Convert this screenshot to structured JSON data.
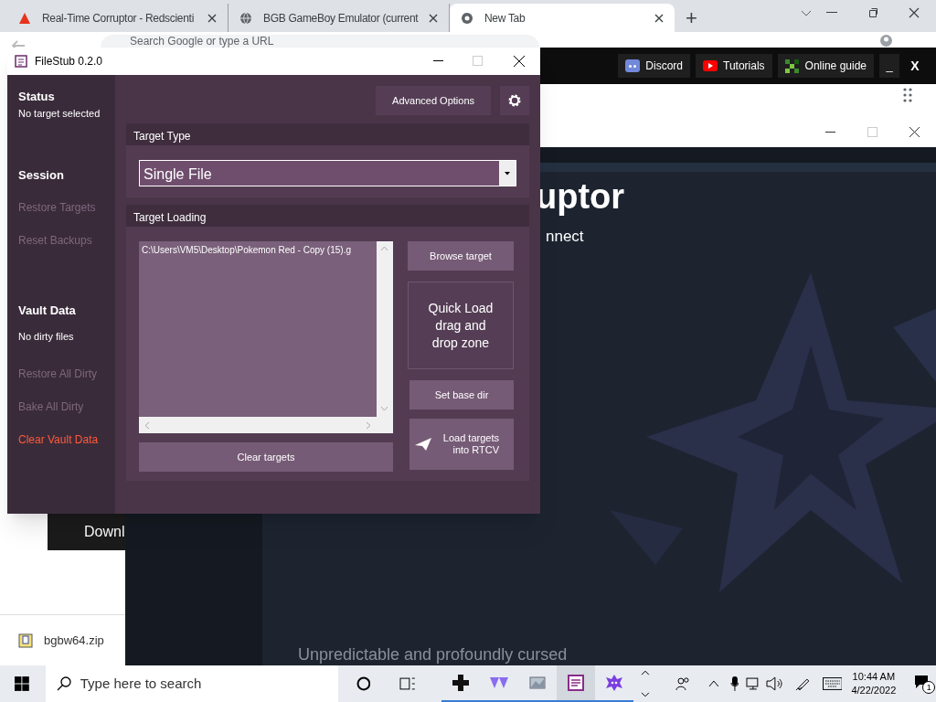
{
  "browser": {
    "tabs": [
      {
        "title": "Real-Time Corruptor - Redscienti",
        "selected": false
      },
      {
        "title": "BGB GameBoy Emulator (current",
        "selected": false
      },
      {
        "title": "New Tab",
        "selected": true
      }
    ],
    "new_tab": "+",
    "address_placeholder": "Search Google or type a URL"
  },
  "launcher_bar": {
    "links": [
      {
        "label": "Discord"
      },
      {
        "label": "Tutorials"
      },
      {
        "label": "Online guide"
      }
    ],
    "minimize": "_",
    "close": "X"
  },
  "rtcv_window": {
    "title_fragment": "uptor",
    "subtitle_fragment": "nnect",
    "tagline": "Unpredictable and profoundly cursed"
  },
  "download_button": "Downl",
  "downloads": [
    {
      "file": "bgbw64.zip"
    }
  ],
  "filestub": {
    "title": "FileStub 0.2.0",
    "sidebar": [
      {
        "kind": "heading",
        "text": "Status"
      },
      {
        "kind": "info",
        "text": "No target selected"
      },
      {
        "kind": "heading",
        "text": "Session"
      },
      {
        "kind": "action",
        "text": "Restore Targets",
        "disabled": true
      },
      {
        "kind": "action",
        "text": "Reset Backups",
        "disabled": true
      },
      {
        "kind": "heading",
        "text": "Vault Data"
      },
      {
        "kind": "info",
        "text": "No dirty files"
      },
      {
        "kind": "action",
        "text": "Restore All Dirty",
        "disabled": true
      },
      {
        "kind": "action",
        "text": "Bake All Dirty",
        "disabled": true
      },
      {
        "kind": "danger",
        "text": "Clear Vault Data",
        "disabled": false
      }
    ],
    "advanced_button": "Advanced Options",
    "target_type": {
      "header": "Target Type",
      "value": "Single File"
    },
    "target_loading": {
      "header": "Target Loading",
      "targets": [
        "C:\\Users\\VM5\\Desktop\\Pokemon Red - Copy (15).g"
      ],
      "browse": "Browse target",
      "drop_zone": "Quick Load drag and drop zone",
      "base_dir": "Set base dir",
      "load": "Load targets into RTCV",
      "clear": "Clear targets"
    }
  },
  "taskbar": {
    "search_placeholder": "Type here to search",
    "time": "10:44 AM",
    "date": "4/22/2022",
    "notifications": "1"
  }
}
